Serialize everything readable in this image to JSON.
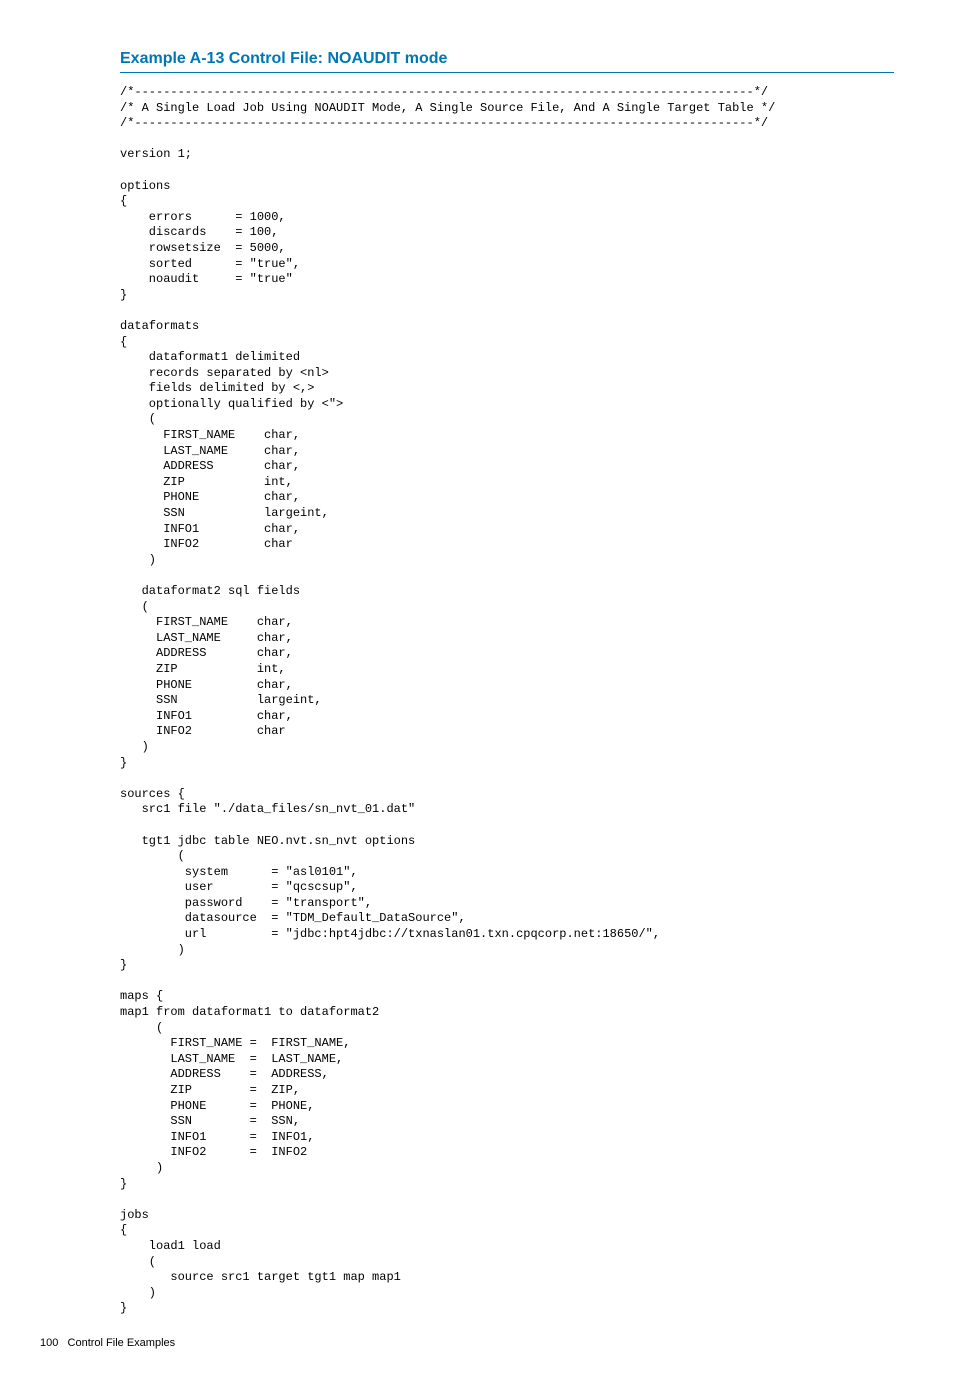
{
  "heading": "Example A-13 Control File: NOAUDIT mode",
  "code": "/*--------------------------------------------------------------------------------------*/\n/* A Single Load Job Using NOAUDIT Mode, A Single Source File, And A Single Target Table */\n/*--------------------------------------------------------------------------------------*/\n\nversion 1;\n\noptions\n{\n    errors      = 1000,\n    discards    = 100,\n    rowsetsize  = 5000,\n    sorted      = \"true\",\n    noaudit     = \"true\"\n}\n\ndataformats\n{\n    dataformat1 delimited\n    records separated by <nl>\n    fields delimited by <,>\n    optionally qualified by <\">\n    (\n      FIRST_NAME    char,\n      LAST_NAME     char,\n      ADDRESS       char,\n      ZIP           int,\n      PHONE         char,\n      SSN           largeint,\n      INFO1         char,\n      INFO2         char\n    )\n\n   dataformat2 sql fields\n   (\n     FIRST_NAME    char,\n     LAST_NAME     char,\n     ADDRESS       char,\n     ZIP           int,\n     PHONE         char,\n     SSN           largeint,\n     INFO1         char,\n     INFO2         char\n   )\n}\n\nsources {\n   src1 file \"./data_files/sn_nvt_01.dat\"\n\n   tgt1 jdbc table NEO.nvt.sn_nvt options\n        (\n         system      = \"asl0101\",\n         user        = \"qcscsup\",\n         password    = \"transport\",\n         datasource  = \"TDM_Default_DataSource\",\n         url         = \"jdbc:hpt4jdbc://txnaslan01.txn.cpqcorp.net:18650/\",\n        )\n}\n\nmaps {\nmap1 from dataformat1 to dataformat2\n     (\n       FIRST_NAME =  FIRST_NAME,\n       LAST_NAME  =  LAST_NAME,\n       ADDRESS    =  ADDRESS,\n       ZIP        =  ZIP,\n       PHONE      =  PHONE,\n       SSN        =  SSN,\n       INFO1      =  INFO1,\n       INFO2      =  INFO2\n     )\n}\n\njobs\n{\n    load1 load\n    (\n       source src1 target tgt1 map map1\n    )\n}",
  "footer": {
    "pagenum": "100",
    "text": "Control File Examples"
  }
}
